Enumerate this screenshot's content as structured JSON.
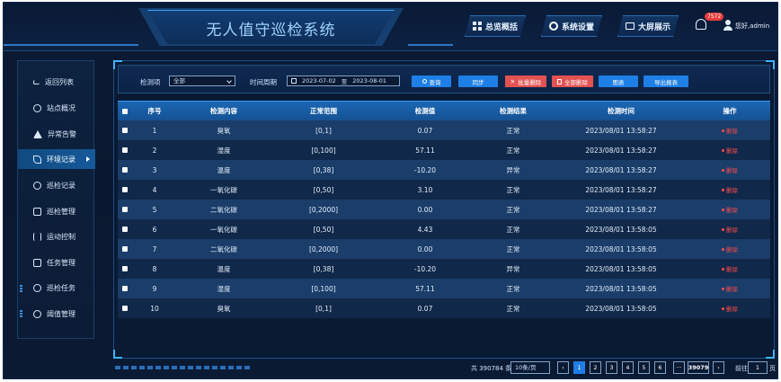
{
  "header": {
    "title": "无人值守巡检系统",
    "nav": [
      {
        "label": "总览概括",
        "icon": "grid-icon"
      },
      {
        "label": "系统设置",
        "icon": "gear-icon"
      },
      {
        "label": "大屏展示",
        "icon": "monitor-icon"
      }
    ],
    "notification_count": "7572",
    "user": "您好,admin"
  },
  "sidebar": {
    "items": [
      {
        "label": "返回列表",
        "icon": "back-arrow-icon"
      },
      {
        "label": "站点概况",
        "icon": "location-icon"
      },
      {
        "label": "异常告警",
        "icon": "warning-icon"
      },
      {
        "label": "环境记录",
        "icon": "leaf-icon",
        "active": true
      },
      {
        "label": "巡检记录",
        "icon": "user-group-icon"
      },
      {
        "label": "巡检管理",
        "icon": "copy-icon"
      },
      {
        "label": "运动控制",
        "icon": "slider-icon"
      },
      {
        "label": "任务管理",
        "icon": "list-icon"
      },
      {
        "label": "巡检任务",
        "icon": "gear-icon"
      },
      {
        "label": "阈值管理",
        "icon": "clock-icon"
      }
    ]
  },
  "filter": {
    "item_label": "检测项",
    "item_value": "全部",
    "period_label": "时间周期",
    "date_start": "2023-07-02",
    "date_sep": "至",
    "date_end": "2023-08-01",
    "buttons": {
      "query": "查询",
      "sync": "同步",
      "batch_delete": "批量删除",
      "delete_all": "全部删除",
      "chart": "图表",
      "export": "导出报表"
    }
  },
  "table": {
    "columns": [
      "序号",
      "检测内容",
      "正常范围",
      "检测值",
      "检测结果",
      "检测时间",
      "操作"
    ],
    "delete_label": "删除",
    "rows": [
      [
        "1",
        "臭氧",
        "[0,1]",
        "0.07",
        "正常",
        "2023/08/01 13:58:27"
      ],
      [
        "2",
        "湿度",
        "[0,100]",
        "57.11",
        "正常",
        "2023/08/01 13:58:27"
      ],
      [
        "3",
        "温度",
        "[0,38]",
        "-10.20",
        "异常",
        "2023/08/01 13:58:27"
      ],
      [
        "4",
        "一氧化碳",
        "[0,50]",
        "3.10",
        "正常",
        "2023/08/01 13:58:27"
      ],
      [
        "5",
        "二氧化碳",
        "[0,2000]",
        "0.00",
        "正常",
        "2023/08/01 13:58:27"
      ],
      [
        "6",
        "一氧化碳",
        "[0,50]",
        "4.43",
        "正常",
        "2023/08/01 13:58:05"
      ],
      [
        "7",
        "二氧化碳",
        "[0,2000]",
        "0.00",
        "正常",
        "2023/08/01 13:58:05"
      ],
      [
        "8",
        "温度",
        "[0,38]",
        "-10.20",
        "异常",
        "2023/08/01 13:58:05"
      ],
      [
        "9",
        "湿度",
        "[0,100]",
        "57.11",
        "正常",
        "2023/08/01 13:58:05"
      ],
      [
        "10",
        "臭氧",
        "[0,1]",
        "0.07",
        "正常",
        "2023/08/01 13:58:05"
      ]
    ]
  },
  "pagination": {
    "total_text": "共 390784 条",
    "page_size": "10条/页",
    "pages": [
      "1",
      "2",
      "3",
      "4",
      "5",
      "6"
    ],
    "ellipsis": "···",
    "last_page": "39079",
    "goto_label": "前往",
    "goto_value": "1",
    "page_suffix": "页"
  },
  "colors": {
    "accent": "#1e7fe6",
    "danger": "#e35252",
    "header_row": "#1b66b3"
  }
}
